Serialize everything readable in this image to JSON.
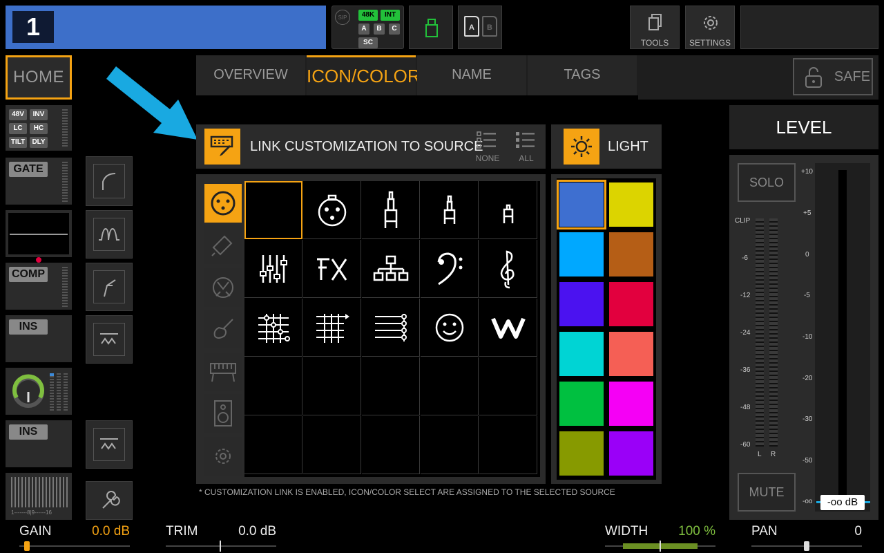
{
  "channel": {
    "number": "1",
    "color": "#3d6fc9"
  },
  "status": {
    "sip_label": "SIP",
    "chip_48k": "48K",
    "chip_int": "INT",
    "chip_a": "A",
    "chip_b": "B",
    "chip_c": "C",
    "chip_sc": "SC",
    "card_a": "A",
    "card_b": "B"
  },
  "toolbar": {
    "tools_label": "TOOLS",
    "settings_label": "SETTINGS"
  },
  "home_label": "HOME",
  "preamp": {
    "b48v": "48V",
    "inv": "INV",
    "lc": "LC",
    "hc": "HC",
    "tilt": "TILT",
    "dly": "DLY"
  },
  "strip": {
    "gate": "GATE",
    "comp": "COMP",
    "ins1": "INS",
    "ins2": "INS",
    "scale": "1-------8|9------16"
  },
  "tabs": [
    {
      "label": "OVERVIEW"
    },
    {
      "label": "ICON/COLOR"
    },
    {
      "label": "NAME"
    },
    {
      "label": "TAGS"
    }
  ],
  "safe_label": "SAFE",
  "link": {
    "title": "LINK CUSTOMIZATION TO SOURCE",
    "none": "NONE",
    "all": "ALL"
  },
  "light_label": "LIGHT",
  "footnote": "* CUSTOMIZATION LINK IS ENABLED, ICON/COLOR SELECT ARE ASSIGNED TO THE SELECTED SOURCE",
  "icons": {
    "row1": [
      "empty",
      "xlr-icon",
      "jack-large-icon",
      "jack-medium-icon",
      "jack-small-icon"
    ],
    "row2": [
      "faders-icon",
      "fx-icon",
      "network-icon",
      "bass-clef-icon",
      "treble-clef-icon"
    ],
    "row3": [
      "bus-matrix-icon",
      "flag-lines-icon",
      "lines-icon",
      "smiley-icon",
      "w-logo-icon"
    ]
  },
  "colors": [
    "#3e6fd0",
    "#dcd400",
    "#00a8ff",
    "#b55e16",
    "#4b12f0",
    "#e2003e",
    "#00d4d4",
    "#f55f55",
    "#00c040",
    "#f500f5",
    "#879a00",
    "#9a00f8"
  ],
  "level": {
    "title": "LEVEL",
    "solo": "SOLO",
    "mute": "MUTE",
    "clip": "CLIP",
    "left_scale": [
      "-6",
      "-12",
      "-24",
      "-36",
      "-48",
      "-60"
    ],
    "lr": [
      "L",
      "R"
    ],
    "right_scale": [
      "+10",
      "+5",
      "0",
      "-5",
      "-10",
      "-20",
      "-30",
      "-50",
      "-oo"
    ],
    "fader_value": "-oo dB"
  },
  "bottom": {
    "gain_label": "GAIN",
    "gain_value": "0.0 dB",
    "trim_label": "TRIM",
    "trim_value": "0.0 dB",
    "width_label": "WIDTH",
    "width_value": "100 %",
    "pan_label": "PAN",
    "pan_value": "0"
  },
  "accent": "#f5a313",
  "arrow_color": "#19a9e1"
}
